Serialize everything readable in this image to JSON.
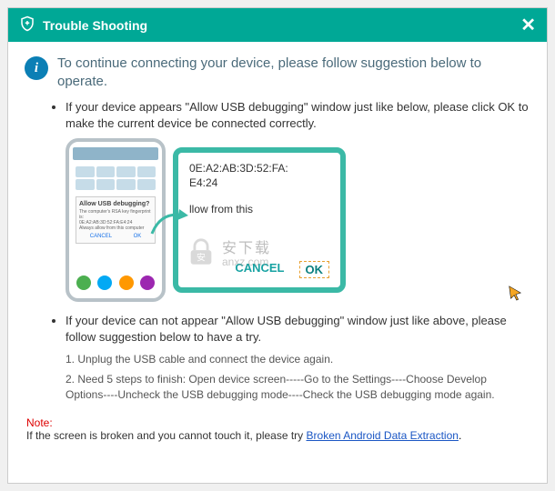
{
  "header": {
    "title": "Trouble Shooting",
    "close": "✕"
  },
  "intro": "To continue connecting your device, please follow suggestion below to operate.",
  "bullets": {
    "b1": "If your device appears \"Allow USB debugging\" window just like below, please click OK to make the current device  be connected correctly.",
    "b2": "If your device can not appear \"Allow USB debugging\" window just like above, please follow suggestion below to have a try."
  },
  "phone_popup": {
    "title": "Allow USB debugging?",
    "line1": "The computer's RSA key fingerprint is:",
    "line2": "0E:A2:AB:3D:52:FA:E4:24",
    "line3": "Always allow from this computer",
    "cancel": "CANCEL",
    "ok": "OK"
  },
  "tablet": {
    "mac": "0E:A2:AB:3D:52:FA:",
    "mac2": "E4:24",
    "mid": "llow from this",
    "cancel": "CANCEL",
    "ok": "OK"
  },
  "steps": {
    "s1": "1. Unplug the USB cable and connect the device again.",
    "s2": "2. Need 5 steps to finish: Open device screen-----Go to the Settings----Choose Develop Options----Uncheck the USB debugging mode----Check the USB debugging mode again."
  },
  "note": {
    "label": "Note:",
    "text": "If the screen is broken and you cannot touch it, please try ",
    "link": "Broken Android Data Extraction",
    "after": "."
  },
  "watermark": {
    "cn": "安下载",
    "url": "anxz.com"
  }
}
